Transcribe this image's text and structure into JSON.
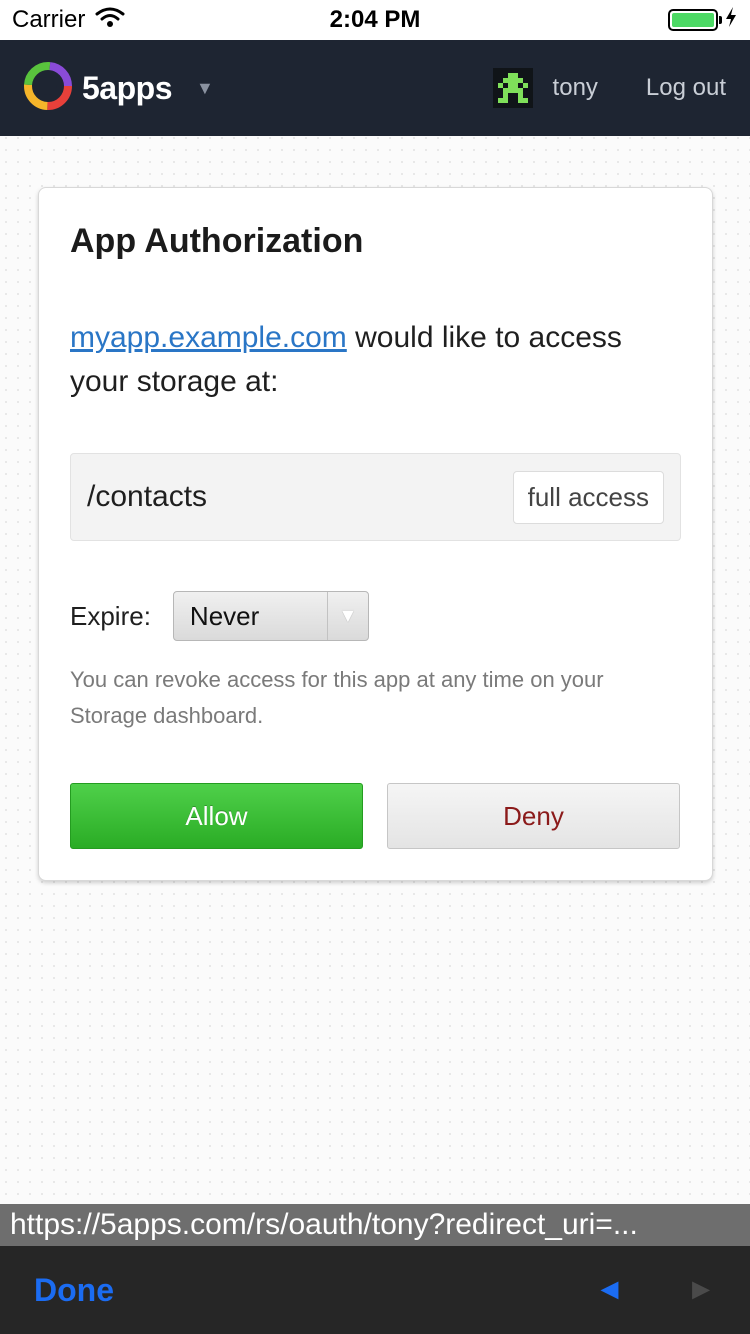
{
  "status_bar": {
    "carrier": "Carrier",
    "time": "2:04 PM",
    "wifi_icon": "wifi-icon",
    "battery_icon": "battery-icon",
    "charging_icon": "charging-bolt-icon",
    "battery_level": 1.0
  },
  "navbar": {
    "brand": "5apps",
    "brand_logo_icon": "5apps-logo-icon",
    "menu_caret_icon": "caret-down-icon",
    "avatar_icon": "pixel-avatar-icon",
    "username": "tony",
    "logout": "Log out",
    "background_color": "#1e2532"
  },
  "authorization": {
    "title": "App Authorization",
    "app_link": "myapp.example.com",
    "request_text": " would like to access your storage at:",
    "scope": {
      "path": "/contacts",
      "access": "full access"
    },
    "expire": {
      "label": "Expire:",
      "selected": "Never",
      "arrow_icon": "select-arrow-icon"
    },
    "help_text": "You can revoke access for this app at any time on your Storage dashboard.",
    "allow_label": "Allow",
    "deny_label": "Deny",
    "allow_color": "#3cbd36",
    "deny_text_color": "#8b1a1a",
    "link_color": "#2a76c6"
  },
  "browser": {
    "url": "https://5apps.com/rs/oauth/tony?redirect_uri=...",
    "done": "Done",
    "back_icon": "back-arrow-icon",
    "forward_icon": "forward-arrow-icon",
    "accent_color": "#1b6cf2"
  }
}
